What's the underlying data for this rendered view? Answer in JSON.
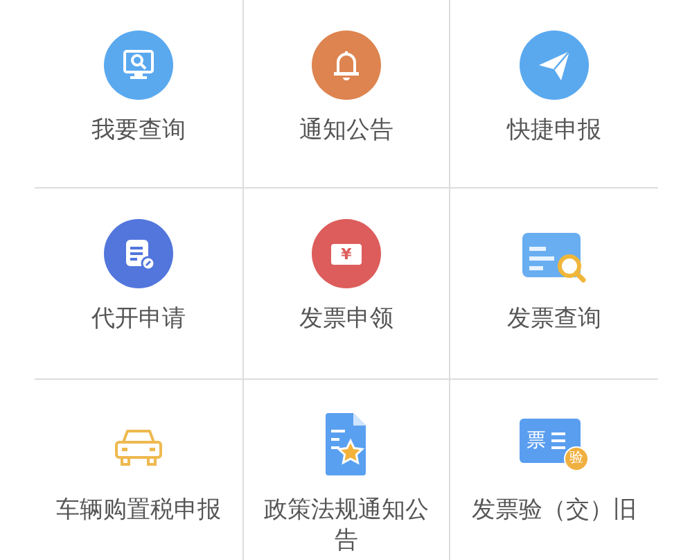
{
  "menu_grid": [
    {
      "label": "我要查询",
      "kind": "monitor-search"
    },
    {
      "label": "通知公告",
      "kind": "bell"
    },
    {
      "label": "快捷申报",
      "kind": "paper-plane"
    },
    {
      "label": "代开申请",
      "kind": "document-edit"
    },
    {
      "label": "发票申领",
      "kind": "ticket",
      "icon_text": "¥"
    },
    {
      "label": "发票查询",
      "kind": "card-search"
    },
    {
      "label": "车辆购置税申报",
      "kind": "car"
    },
    {
      "label": "政策法规通知公告",
      "kind": "document-star"
    },
    {
      "label": "发票验（交）旧",
      "kind": "invoice-badge",
      "icon_text": "票",
      "badge_text": "验"
    }
  ]
}
